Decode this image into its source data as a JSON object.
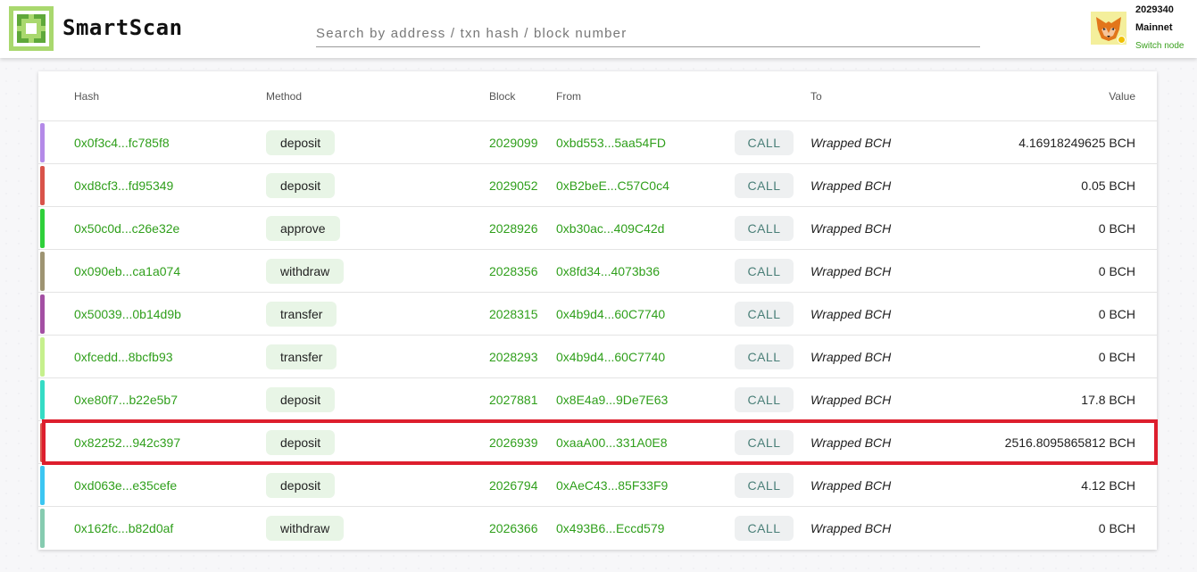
{
  "header": {
    "brand": "SmartScan",
    "search_placeholder": "Search by address / txn hash / block number",
    "block_number": "2029340",
    "network": "Mainnet",
    "switch_node": "Switch node"
  },
  "table": {
    "columns": {
      "hash": "Hash",
      "method": "Method",
      "block": "Block",
      "from": "From",
      "to": "To",
      "value": "Value"
    },
    "rows": [
      {
        "color": "#b48ae8",
        "hash": "0x0f3c4...fc785f8",
        "method": "deposit",
        "block": "2029099",
        "from": "0xbd553...5aa54FD",
        "call": "CALL",
        "to": "Wrapped BCH",
        "value": "4.16918249625 BCH"
      },
      {
        "color": "#d9534a",
        "hash": "0xd8cf3...fd95349",
        "method": "deposit",
        "block": "2029052",
        "from": "0xB2beE...C57C0c4",
        "call": "CALL",
        "to": "Wrapped BCH",
        "value": "0.05 BCH"
      },
      {
        "color": "#2fd03a",
        "hash": "0x50c0d...c26e32e",
        "method": "approve",
        "block": "2028926",
        "from": "0xb30ac...409C42d",
        "call": "CALL",
        "to": "Wrapped BCH",
        "value": "0 BCH"
      },
      {
        "color": "#9e9472",
        "hash": "0x090eb...ca1a074",
        "method": "withdraw",
        "block": "2028356",
        "from": "0x8fd34...4073b36",
        "call": "CALL",
        "to": "Wrapped BCH",
        "value": "0 BCH"
      },
      {
        "color": "#a34fa3",
        "hash": "0x50039...0b14d9b",
        "method": "transfer",
        "block": "2028315",
        "from": "0x4b9d4...60C7740",
        "call": "CALL",
        "to": "Wrapped BCH",
        "value": "0 BCH"
      },
      {
        "color": "#c6f08d",
        "hash": "0xfcedd...8bcfb93",
        "method": "transfer",
        "block": "2028293",
        "from": "0x4b9d4...60C7740",
        "call": "CALL",
        "to": "Wrapped BCH",
        "value": "0 BCH"
      },
      {
        "color": "#35dcc5",
        "hash": "0xe80f7...b22e5b7",
        "method": "deposit",
        "block": "2027881",
        "from": "0x8E4a9...9De7E63",
        "call": "CALL",
        "to": "Wrapped BCH",
        "value": "17.8 BCH"
      },
      {
        "color": "#d9534a",
        "hash": "0x82252...942c397",
        "method": "deposit",
        "block": "2026939",
        "from": "0xaaA00...331A0E8",
        "call": "CALL",
        "to": "Wrapped BCH",
        "value": "2516.8095865812 BCH"
      },
      {
        "color": "#3cc6f2",
        "hash": "0xd063e...e35cefe",
        "method": "deposit",
        "block": "2026794",
        "from": "0xAeC43...85F33F9",
        "call": "CALL",
        "to": "Wrapped BCH",
        "value": "4.12 BCH"
      },
      {
        "color": "#86cbb0",
        "hash": "0x162fc...b82d0af",
        "method": "withdraw",
        "block": "2026366",
        "from": "0x493B6...Eccd579",
        "call": "CALL",
        "to": "Wrapped BCH",
        "value": "0 BCH"
      }
    ]
  },
  "colors": {
    "accent_green": "#2f9f1b",
    "highlight_red": "#dd1e2d"
  },
  "icons": {
    "logo": "smartscan-logo-icon",
    "avatar": "metamask-fox-icon"
  }
}
